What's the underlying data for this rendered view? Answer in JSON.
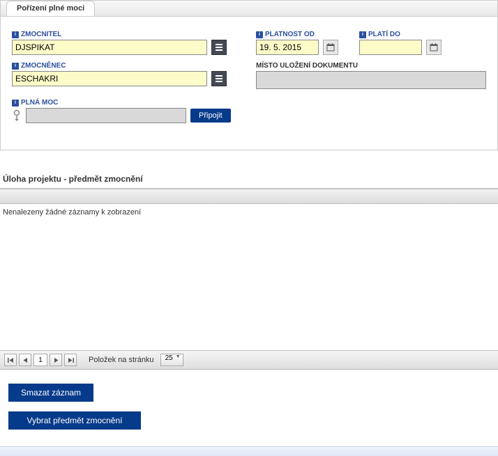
{
  "tab": {
    "title": "Pořízení plné moci"
  },
  "fields": {
    "zmocnitel": {
      "label": "ZMOCNITEL",
      "value": "DJSPIKAT"
    },
    "zmocnenec": {
      "label": "ZMOCNĚNEC",
      "value": "ESCHAKRI"
    },
    "plna_moc": {
      "label": "PLNÁ MOC",
      "value": ""
    },
    "platnost_od": {
      "label": "PLATNOST OD",
      "value": "19. 5. 2015"
    },
    "plati_do": {
      "label": "PLATÍ DO",
      "value": ""
    },
    "misto": {
      "label": "MÍSTO ULOŽENÍ DOKUMENTU",
      "value": ""
    },
    "pripojit": "Připojit"
  },
  "section": {
    "title": "Úloha projektu - předmět zmocnění"
  },
  "grid": {
    "empty": "Nenalezeny žádné záznamy k zobrazení"
  },
  "pager": {
    "page": "1",
    "items_label": "Položek na stránku",
    "page_size": "25"
  },
  "buttons": {
    "delete": "Smazat záznam",
    "select_subject": "Vybrat předmět zmocnění"
  }
}
